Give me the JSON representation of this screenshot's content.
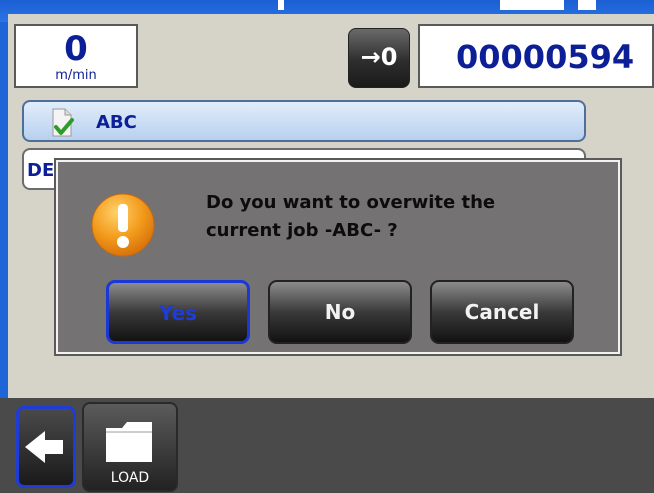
{
  "speed": {
    "value": "0",
    "unit": "m/min"
  },
  "counter": {
    "reset_icon": "reset-to-zero-icon",
    "reset_label": "→0",
    "value": "00000594"
  },
  "jobs": [
    {
      "name": "ABC",
      "icon": "document-check-icon"
    },
    {
      "name": "DE"
    }
  ],
  "dialog": {
    "icon": "warning-icon",
    "message_line1": "Do you want to overwite the",
    "message_line2": "current job -ABC- ?",
    "buttons": {
      "yes": "Yes",
      "no": "No",
      "cancel": "Cancel"
    }
  },
  "toolbar": {
    "back_icon": "back-arrow-icon",
    "load_label": "LOAD",
    "load_icon": "folder-icon"
  },
  "colors": {
    "frame_blue": "#1e66d8",
    "text_navy": "#0d1f96",
    "focus_blue": "#1f3bd8",
    "dialog_gray": "#747272",
    "warning_orange": "#f29a1b"
  }
}
